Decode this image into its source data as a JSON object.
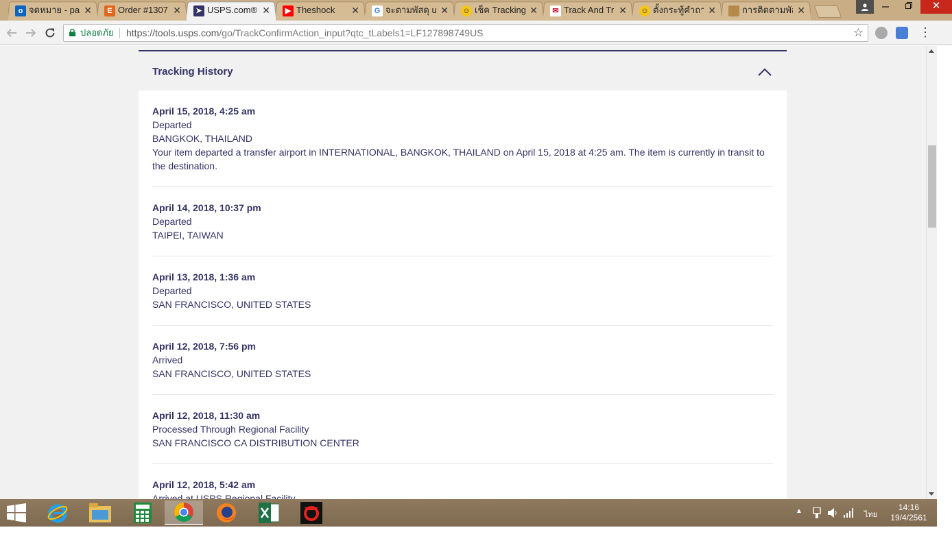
{
  "browser": {
    "tabs": [
      {
        "title": "จดหมาย - part",
        "favicon": "outlook-icon",
        "color": "#0b64c0",
        "active": false
      },
      {
        "title": "Order #1307",
        "favicon": "etsy-icon",
        "color": "#e3661e",
        "active": false
      },
      {
        "title": "USPS.com®",
        "favicon": "usps-icon",
        "color": "#333366",
        "active": true
      },
      {
        "title": "Theshock",
        "favicon": "youtube-icon",
        "color": "#ff0000",
        "active": false
      },
      {
        "title": "จะตามพัสดุ usp",
        "favicon": "google-icon",
        "color": "#4285f4",
        "active": false
      },
      {
        "title": "เช็ค Tracking",
        "favicon": "emoji-icon",
        "color": "#f5c518",
        "active": false
      },
      {
        "title": "Track And Tr",
        "favicon": "thaipost-icon",
        "color": "#c8102e",
        "active": false
      },
      {
        "title": "ตั้งกระทู้คำถาม",
        "favicon": "emoji-icon",
        "color": "#f5c518",
        "active": false
      },
      {
        "title": "การติดตามพัสดุ",
        "favicon": "page-icon",
        "color": "#b48a4a",
        "active": false
      }
    ],
    "close_glyph": "✕",
    "secure_label": "ปลอดภัย",
    "url_host": "https://tools.usps.com",
    "url_path": "/go/TrackConfirmAction_input?qtc_tLabels1=LF127898749US"
  },
  "tracking": {
    "section_title": "Tracking History",
    "events": [
      {
        "date": "April 15, 2018, 4:25 am",
        "status": "Departed",
        "location": "BANGKOK, THAILAND",
        "detail": "Your item departed a transfer airport in INTERNATIONAL, BANGKOK, THAILAND on April 15, 2018 at 4:25 am. The item is currently in transit to the destination."
      },
      {
        "date": "April 14, 2018, 10:37 pm",
        "status": "Departed",
        "location": "TAIPEI, TAIWAN",
        "detail": ""
      },
      {
        "date": "April 13, 2018, 1:36 am",
        "status": "Departed",
        "location": "SAN FRANCISCO, UNITED STATES",
        "detail": ""
      },
      {
        "date": "April 12, 2018, 7:56 pm",
        "status": "Arrived",
        "location": "SAN FRANCISCO, UNITED STATES",
        "detail": ""
      },
      {
        "date": "April 12, 2018, 11:30 am",
        "status": "Processed Through Regional Facility",
        "location": "SAN FRANCISCO CA DISTRIBUTION CENTER",
        "detail": ""
      },
      {
        "date": "April 12, 2018, 5:42 am",
        "status": "Arrived at USPS Regional Facility",
        "location": "",
        "detail": ""
      }
    ]
  },
  "taskbar": {
    "apps": [
      "start-icon",
      "internet-explorer-icon",
      "file-explorer-icon",
      "calculator-icon",
      "chrome-icon",
      "firefox-icon",
      "excel-icon",
      "garena-icon"
    ],
    "language": "ไทย",
    "time": "14:16",
    "date": "19/4/2561"
  },
  "colors": {
    "usps_navy": "#333366",
    "tab_strip": "#c9ad84",
    "secure_green": "#0b8043"
  }
}
